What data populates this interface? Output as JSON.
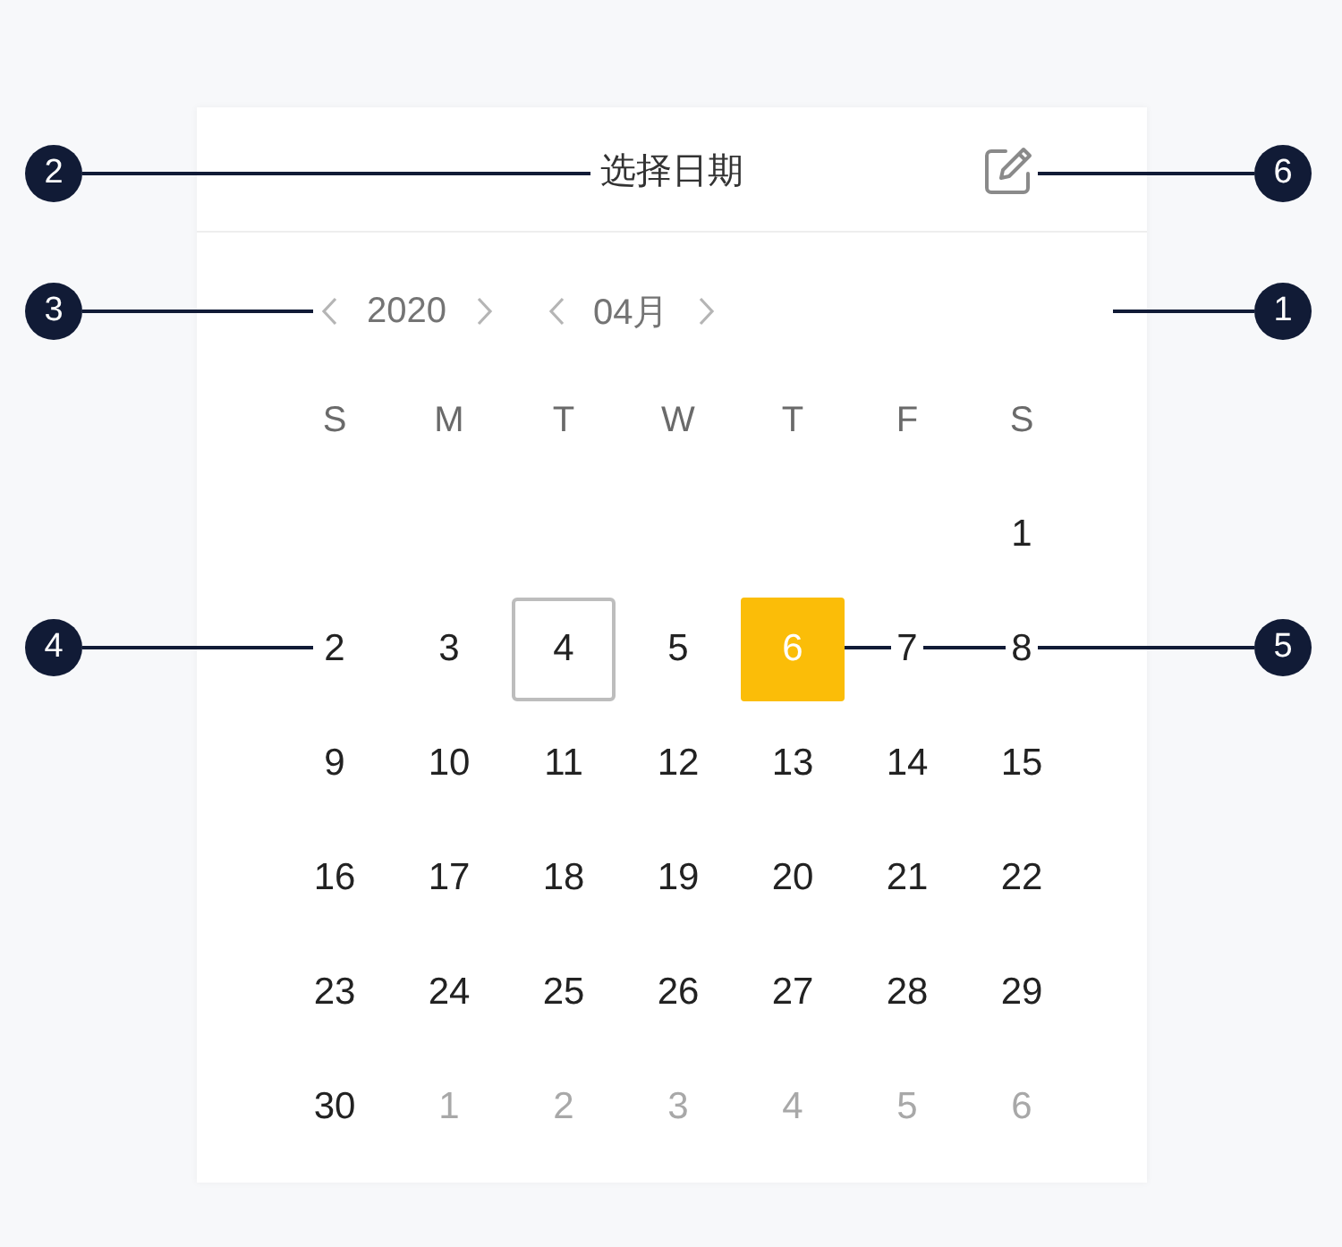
{
  "header": {
    "title": "选择日期"
  },
  "navigation": {
    "year": "2020",
    "month": "04月"
  },
  "calendar": {
    "weekdays": [
      "S",
      "M",
      "T",
      "W",
      "T",
      "F",
      "S"
    ],
    "weeks": [
      [
        {
          "label": "1",
          "selected": false,
          "today": false,
          "dimmed": false
        }
      ],
      [
        {
          "label": "2",
          "selected": false,
          "today": false,
          "dimmed": false
        },
        {
          "label": "3",
          "selected": false,
          "today": false,
          "dimmed": false
        },
        {
          "label": "4",
          "selected": false,
          "today": true,
          "dimmed": false
        },
        {
          "label": "5",
          "selected": false,
          "today": false,
          "dimmed": false
        },
        {
          "label": "6",
          "selected": true,
          "today": false,
          "dimmed": false
        },
        {
          "label": "7",
          "selected": false,
          "today": false,
          "dimmed": false
        },
        {
          "label": "8",
          "selected": false,
          "today": false,
          "dimmed": false
        }
      ],
      [
        {
          "label": "9",
          "selected": false,
          "today": false,
          "dimmed": false
        },
        {
          "label": "10",
          "selected": false,
          "today": false,
          "dimmed": false
        },
        {
          "label": "11",
          "selected": false,
          "today": false,
          "dimmed": false
        },
        {
          "label": "12",
          "selected": false,
          "today": false,
          "dimmed": false
        },
        {
          "label": "13",
          "selected": false,
          "today": false,
          "dimmed": false
        },
        {
          "label": "14",
          "selected": false,
          "today": false,
          "dimmed": false
        },
        {
          "label": "15",
          "selected": false,
          "today": false,
          "dimmed": false
        }
      ],
      [
        {
          "label": "16",
          "selected": false,
          "today": false,
          "dimmed": false
        },
        {
          "label": "17",
          "selected": false,
          "today": false,
          "dimmed": false
        },
        {
          "label": "18",
          "selected": false,
          "today": false,
          "dimmed": false
        },
        {
          "label": "19",
          "selected": false,
          "today": false,
          "dimmed": false
        },
        {
          "label": "20",
          "selected": false,
          "today": false,
          "dimmed": false
        },
        {
          "label": "21",
          "selected": false,
          "today": false,
          "dimmed": false
        },
        {
          "label": "22",
          "selected": false,
          "today": false,
          "dimmed": false
        }
      ],
      [
        {
          "label": "23",
          "selected": false,
          "today": false,
          "dimmed": false
        },
        {
          "label": "24",
          "selected": false,
          "today": false,
          "dimmed": false
        },
        {
          "label": "25",
          "selected": false,
          "today": false,
          "dimmed": false
        },
        {
          "label": "26",
          "selected": false,
          "today": false,
          "dimmed": false
        },
        {
          "label": "27",
          "selected": false,
          "today": false,
          "dimmed": false
        },
        {
          "label": "28",
          "selected": false,
          "today": false,
          "dimmed": false
        },
        {
          "label": "29",
          "selected": false,
          "today": false,
          "dimmed": false
        }
      ],
      [
        {
          "label": "30",
          "selected": false,
          "today": false,
          "dimmed": false
        },
        {
          "label": "1",
          "selected": false,
          "today": false,
          "dimmed": true
        },
        {
          "label": "2",
          "selected": false,
          "today": false,
          "dimmed": true
        },
        {
          "label": "3",
          "selected": false,
          "today": false,
          "dimmed": true
        },
        {
          "label": "4",
          "selected": false,
          "today": false,
          "dimmed": true
        },
        {
          "label": "5",
          "selected": false,
          "today": false,
          "dimmed": true
        },
        {
          "label": "6",
          "selected": false,
          "today": false,
          "dimmed": true
        }
      ]
    ]
  },
  "callouts": [
    {
      "number": "2"
    },
    {
      "number": "6"
    },
    {
      "number": "3"
    },
    {
      "number": "1"
    },
    {
      "number": "4"
    },
    {
      "number": "5"
    }
  ]
}
